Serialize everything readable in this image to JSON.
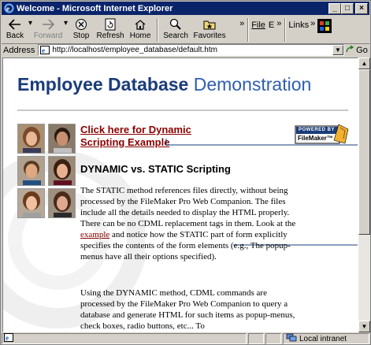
{
  "window": {
    "title": "Welcome - Microsoft Internet Explorer",
    "minimize": "_",
    "maximize": "□",
    "close": "×"
  },
  "toolbar": {
    "back": "Back",
    "forward": "Forward",
    "stop": "Stop",
    "refresh": "Refresh",
    "home": "Home",
    "search": "Search",
    "favorites": "Favorites",
    "more": "»",
    "file_menu": "File",
    "edit_menu": "E",
    "links": "Links"
  },
  "address": {
    "label": "Address",
    "url": "http://localhost/employee_database/default.htm",
    "go": "Go"
  },
  "page": {
    "title_bold": "Employee Database",
    "title_light": "Demonstration",
    "dynamic_link": "Click here for Dynamic Scripting Example",
    "badge_top": "POWERED BY",
    "badge_bottom": "FileMaker™",
    "section_heading": "DYNAMIC vs. STATIC Scripting",
    "para1_before": "The STATIC method references files directly, without being processed by the FileMaker Pro Web Companion. The files include all the details needed to display the HTML properly. There can be no CDML replacement tags in them. Look at the ",
    "para1_link": "example",
    "para1_after": " and notice how the STATIC part of form explicitly specifies the contents of the form elements (e.g., The popup-menus have all their options specified).",
    "para2": "Using the DYNAMIC method, CDML commands are processed by the FileMaker Pro Web Companion to query a database and generate HTML for such items as popup-menus, check boxes, radio buttons, etc... To"
  },
  "status": {
    "zone": "Local intranet"
  },
  "colors": {
    "titlebar": "#0a246a",
    "heading_blue": "#1a3c7a",
    "link_red": "#8b0000"
  }
}
